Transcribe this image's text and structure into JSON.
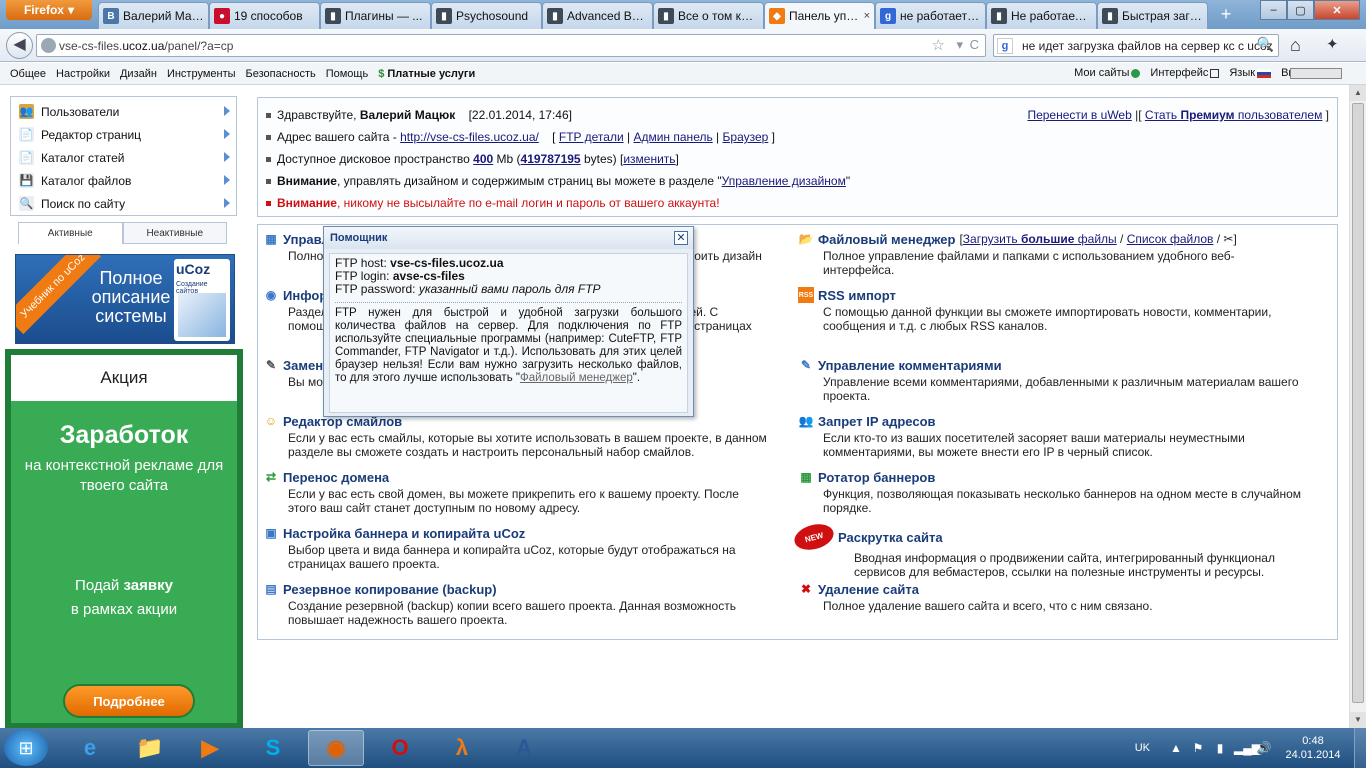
{
  "browser": {
    "menu_label": "Firefox",
    "tabs": [
      {
        "label": "Валерий Мацюк",
        "icon": "vk-icon",
        "color": "#4a76a8",
        "glyph": "В"
      },
      {
        "label": "19 способов",
        "icon": "red-circle-icon",
        "color": "#c8102e",
        "glyph": "●"
      },
      {
        "label": "Плагины — ...",
        "icon": "plugin-icon",
        "color": "#3f4a58",
        "glyph": "▮"
      },
      {
        "label": "Psychosound",
        "icon": "site-icon",
        "color": "#3f4a58",
        "glyph": "▮"
      },
      {
        "label": "Advanced Ba...",
        "icon": "site-icon",
        "color": "#3f4a58",
        "glyph": "▮"
      },
      {
        "label": "Все о том как...",
        "icon": "site-icon",
        "color": "#3f4a58",
        "glyph": "▮"
      },
      {
        "label": "Панель упр...",
        "icon": "ucoz-icon",
        "color": "#f07b12",
        "glyph": "◆",
        "active": true
      },
      {
        "label": "не работает б...",
        "icon": "google-icon",
        "color": "#3367d6",
        "glyph": "g"
      },
      {
        "label": "Не работает ...",
        "icon": "site-icon",
        "color": "#3f4a58",
        "glyph": "▮"
      },
      {
        "label": "Быстрая загр...",
        "icon": "site-icon",
        "color": "#3f4a58",
        "glyph": "▮"
      }
    ],
    "close_tab_glyph": "×",
    "new_tab_glyph": "+",
    "window_controls": {
      "minimize": "–",
      "maximize": "▢",
      "close": "✕"
    },
    "url_prefix": "vse-cs-files.",
    "url_domain": "ucoz.ua",
    "url_suffix": "/panel/?a=cp",
    "search_text": "не идет загрузка файлов на сервер кс с ucoz",
    "star_glyph": "☆",
    "dropdown_glyph": "▾",
    "reload_glyph": "C",
    "search_glyph": "🔍",
    "home_glyph": "⌂",
    "bookmarks_glyph": "✦",
    "back_glyph": "◀"
  },
  "ucoz_menu": {
    "items": [
      "Общее",
      "Настройки",
      "Дизайн",
      "Инструменты",
      "Безопасность",
      "Помощь"
    ],
    "paid": "Платные услуги",
    "paid_glyph": "$",
    "my_sites": "Мои сайты",
    "interface": "Интерфейс",
    "language": "Язык",
    "exit": "Выход"
  },
  "sidebar": {
    "items": [
      {
        "label": "Пользователи",
        "icon": "users-icon",
        "glyph": "👥",
        "color": "#d9a441"
      },
      {
        "label": "Редактор страниц",
        "icon": "page-editor-icon",
        "glyph": "📄",
        "color": "#e9eef5"
      },
      {
        "label": "Каталог статей",
        "icon": "articles-icon",
        "glyph": "📄",
        "color": "#e9eef5"
      },
      {
        "label": "Каталог файлов",
        "icon": "files-icon",
        "glyph": "💾",
        "color": "#e9eef5"
      },
      {
        "label": "Поиск по сайту",
        "icon": "search-icon",
        "glyph": "🔍",
        "color": "#e9eef5"
      }
    ],
    "tab_active": "Активные",
    "tab_inactive": "Неактивные"
  },
  "banner": {
    "ribbon": "Учебник по uCoz",
    "text": "Полное описание системы",
    "logo": "uCoz",
    "logo_sub": "Создание сайтов"
  },
  "promo": {
    "header": "Акция",
    "title": "Заработок",
    "subtitle": "на контекстной рекламе для твоего сайта",
    "cta_prefix": "Подай",
    "cta_bold": "заявку",
    "cta_suffix": "в рамках акции",
    "button": "Подробнее"
  },
  "welcome": {
    "hello": "Здравствуйте,",
    "user": "Валерий Мацюк",
    "datetime": "[22.01.2014, 17:46]",
    "move": "Перенести в uWeb",
    "premium_prefix": "Стать",
    "premium_bold": "Премиум",
    "premium_suffix": "пользователем",
    "site_label": "Адрес вашего сайта -",
    "site_url": "http://vse-cs-files.ucoz.ua/",
    "ftp_details": "FTP детали",
    "admin_panel": "Админ панель",
    "browser": "Браузер",
    "disk_label": "Доступное дисковое пространство",
    "disk_mb": "400",
    "disk_mb_unit": "Mb",
    "disk_bytes": "419787195",
    "disk_bytes_unit": "bytes",
    "change": "изменить",
    "attention1_bold": "Внимание",
    "attention1_text": ", управлять дизайном и содержимым страниц вы можете в разделе \"",
    "attention1_link": "Управление дизайном",
    "attention1_end": "\"",
    "attention2_bold": "Внимание",
    "attention2_text": ", никому не высылайте по e-mail логин и пароль от вашего аккаунта!"
  },
  "features_left": [
    {
      "title": "Управление дизайном",
      "icon": "design-icon",
      "glyph": "▦",
      "color": "#3c78c8",
      "desc": "Полное управление дизайном сайта. Здесь вы можете изменить и настроить дизайн"
    },
    {
      "title": "Информер",
      "icon": "informer-icon",
      "glyph": "◉",
      "color": "#3c78c8",
      "desc": "Раздел позволяет настраивать вывод информации из различных модулей. С помощью информеров можно вывести последние материалы на любых страницах"
    },
    {
      "title": "Замена шаблонов",
      "icon": "templates-icon",
      "glyph": "✎",
      "color": "#555",
      "desc": "Вы можете выполнить массовую замену в шаблонах вашего проекта"
    },
    {
      "title": "Редактор смайлов",
      "icon": "smiley-icon",
      "glyph": "☺",
      "color": "#e0a000",
      "desc": "Если у вас есть смайлы, которые вы хотите использовать в вашем проекте, в данном разделе вы сможете создать и настроить персональный набор смайлов."
    },
    {
      "title": "Перенос домена",
      "icon": "domain-icon",
      "glyph": "⇄",
      "color": "#2a9a3a",
      "desc": "Если у вас есть свой домен, вы можете прикрепить его к вашему проекту. После этого ваш сайт станет доступным по новому адресу."
    },
    {
      "title": "Настройка баннера и копирайта uCoz",
      "icon": "banner-settings-icon",
      "glyph": "▣",
      "color": "#3c78c8",
      "desc": "Выбор цвета и вида баннера и копирайта uCoz, которые будут отображаться на страницах вашего проекта."
    },
    {
      "title": "Резервное копирование (backup)",
      "icon": "backup-icon",
      "glyph": "▤",
      "color": "#3c78c8",
      "desc": "Создание резервной (backup) копии всего вашего проекта. Данная возможность повышает надежность вашего проекта."
    }
  ],
  "features_right": [
    {
      "title": "Файловый менеджер",
      "icon": "folder-icon",
      "glyph": "📂",
      "color": "#d9a441",
      "desc": "Полное управление файлами и папками с использованием удобного веб-интерфейса."
    },
    {
      "title": "RSS импорт",
      "icon": "rss-icon",
      "glyph": "RSS",
      "color": "#f07b12",
      "desc": "С помощью данной функции вы сможете импортировать новости, комментарии, сообщения и т.д. с любых RSS каналов."
    },
    {
      "title": "Управление комментариями",
      "icon": "comments-icon",
      "glyph": "✎",
      "color": "#3c78c8",
      "desc": "Управление всеми комментариями, добавленными к различным материалам вашего проекта."
    },
    {
      "title": "Запрет IP адресов",
      "icon": "ip-ban-icon",
      "glyph": "👥",
      "color": "#3c78c8",
      "desc": "Если кто-то из ваших посетителей засоряет ваши материалы неуместными комментариями, вы можете внести его IP в черный список."
    },
    {
      "title": "Ротатор баннеров",
      "icon": "rotator-icon",
      "glyph": "▦",
      "color": "#2a9a3a",
      "desc": "Функция, позволяющая показывать несколько баннеров на одном месте в случайном порядке."
    },
    {
      "title": "Раскрутка сайта",
      "icon": "new-badge-icon",
      "glyph": "NEW",
      "color": "#d01010",
      "desc": "Вводная информация о продвижении сайта, интегрированный функционал сервисов для вебмастеров, ссылки на полезные инструменты и ресурсы."
    },
    {
      "title": "Удаление сайта",
      "icon": "delete-icon",
      "glyph": "✖",
      "color": "#d01010",
      "desc": "Полное удаление вашего сайта и всего, что с ним связано."
    }
  ],
  "file_manager_extra": {
    "upload_prefix": "Загрузить",
    "upload_bold": "большие",
    "upload_suffix": "файлы",
    "list": "Список файлов",
    "tool_glyph": "✂"
  },
  "popup": {
    "title": "Помощник",
    "close": "✕",
    "host_label": "FTP host:",
    "host": "vse-cs-files.ucoz.ua",
    "login_label": "FTP login:",
    "login": "avse-cs-files",
    "password_label": "FTP password:",
    "password": "указанный вами пароль для FTP",
    "text": "FTP нужен для быстрой и удобной загрузки большого количества файлов на сервер. Для подключения по FTP используйте специальные программы (например: CuteFTP, FTP Commander, FTP Navigator и т.д.). Использовать для этих целей браузер нельзя! Если вам нужно загрузить несколько файлов, то для этого лучше использовать \"",
    "link": "Файловый менеджер",
    "text_end": "\"."
  },
  "taskbar": {
    "start_glyph": "⊞",
    "apps": [
      {
        "name": "ie-icon",
        "glyph": "e",
        "color": "#3ba0e8"
      },
      {
        "name": "explorer-icon",
        "glyph": "📁",
        "color": "#e8c060"
      },
      {
        "name": "media-player-icon",
        "glyph": "▶",
        "color": "#f07b12"
      },
      {
        "name": "skype-icon",
        "glyph": "S",
        "color": "#00aff0"
      },
      {
        "name": "firefox-icon",
        "glyph": "◉",
        "color": "#e66000",
        "active": true
      },
      {
        "name": "opera-icon",
        "glyph": "O",
        "color": "#d01010"
      },
      {
        "name": "half-life-icon",
        "glyph": "λ",
        "color": "#f07b12"
      },
      {
        "name": "word-icon",
        "glyph": "A",
        "color": "#2b5797"
      }
    ],
    "lang": "UK",
    "time": "0:48",
    "date": "24.01.2014"
  }
}
